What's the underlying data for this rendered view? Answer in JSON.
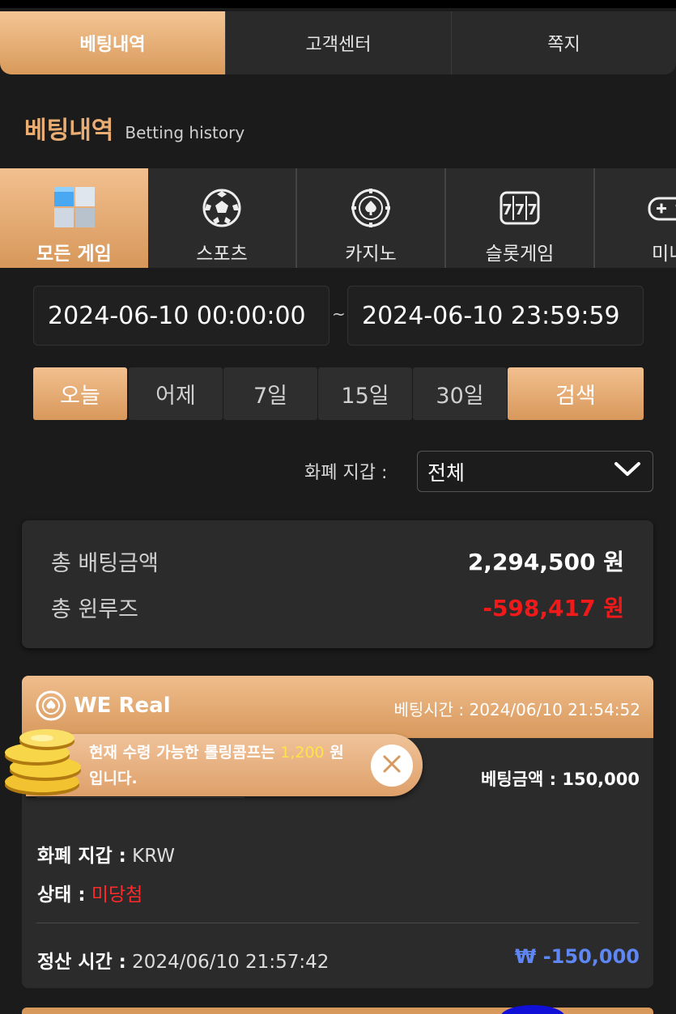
{
  "top_tabs": [
    "베팅내역",
    "고객센터",
    "쪽지"
  ],
  "section": {
    "title": "베팅내역",
    "subtitle": "Betting history"
  },
  "game_tabs": [
    {
      "label": "모든 게임",
      "icon": "cubes-icon"
    },
    {
      "label": "스포츠",
      "icon": "soccer-ball-icon"
    },
    {
      "label": "카지노",
      "icon": "casino-chip-icon"
    },
    {
      "label": "슬롯게임",
      "icon": "slot-777-icon"
    },
    {
      "label": "미니",
      "icon": "gamepad-icon"
    }
  ],
  "date_range": {
    "from": "2024-06-10 00:00:00",
    "separator": "~",
    "to": "2024-06-10 23:59:59"
  },
  "period_buttons": [
    "오늘",
    "어제",
    "7일",
    "15일",
    "30일"
  ],
  "search_label": "검색",
  "wallet": {
    "label": "화폐 지갑 :",
    "selected": "전체"
  },
  "summary": {
    "total_bet_label": "총 배팅금액",
    "total_bet_value": "2,294,500 원",
    "total_winloss_label": "총 윈루즈",
    "total_winloss_value": "-598,417 원"
  },
  "bet_card": {
    "game": "WE Real",
    "bet_time_label": "베팅시간 :",
    "bet_time": "2024/06/10 21:54:52",
    "bet_amount_label": "베팅금액 :",
    "bet_amount": "150,000",
    "wallet_label": "화폐 지갑 :",
    "wallet_value": "KRW",
    "status_label": "상태 :",
    "status_value": "미당첨",
    "settle_label": "정산 시간 :",
    "settle_time": "2024/06/10 21:57:42",
    "payout": "₩ -150,000"
  },
  "toast": {
    "message_prefix": "현재 수령 가능한 롤링콤프는",
    "amount": "1,200",
    "message_suffix_1": "원",
    "message_suffix_2": "입니다."
  },
  "colors": {
    "accent": "#d8995d",
    "negative": "#f01a1a",
    "payout": "#5f86f5",
    "highlight": "#ffe34a"
  }
}
